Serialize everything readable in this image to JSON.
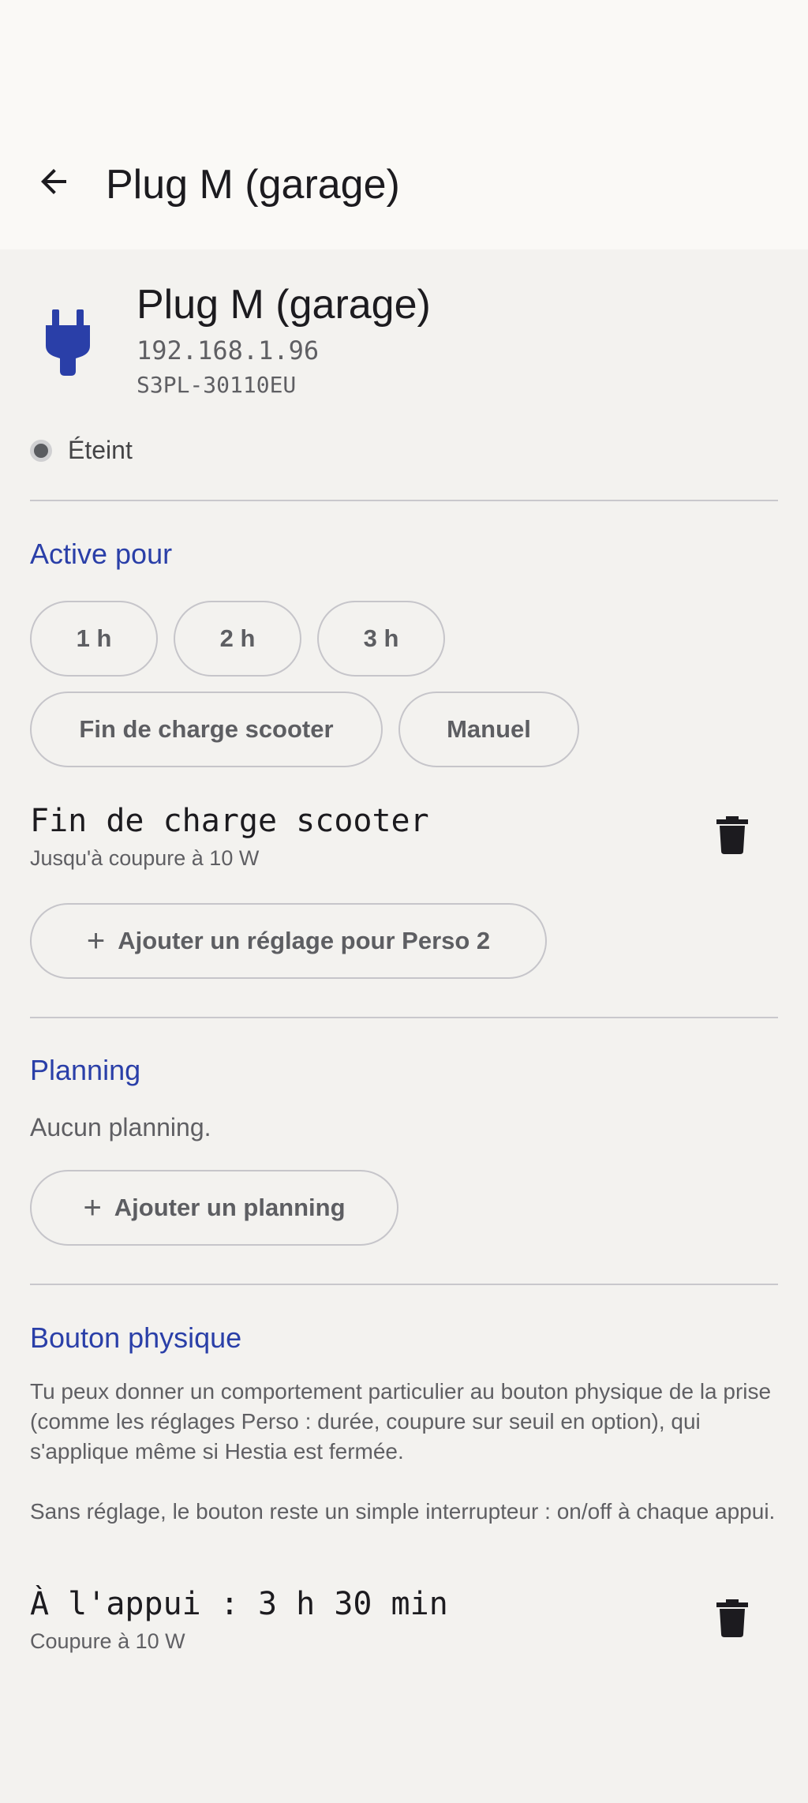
{
  "appbar": {
    "back_icon": "arrow-back-icon",
    "title": "Plug M (garage)"
  },
  "device": {
    "icon": "power-plug-icon",
    "accent_color": "#2a3fa8",
    "name": "Plug M (garage)",
    "ip": "192.168.1.96",
    "model": "S3PL-30110EU",
    "status": "Éteint"
  },
  "active": {
    "title": "Active pour",
    "chips": [
      "1 h",
      "2 h",
      "3 h",
      "Fin de charge scooter",
      "Manuel"
    ],
    "setting": {
      "title": "Fin de charge scooter",
      "subtitle": "Jusqu'à coupure à 10 W"
    },
    "add_label": "Ajouter un réglage pour Perso 2"
  },
  "planning": {
    "title": "Planning",
    "empty_text": "Aucun planning.",
    "add_label": "Ajouter un planning"
  },
  "physical_button": {
    "title": "Bouton physique",
    "paragraph1": "Tu peux donner un comportement particulier au bouton physique de la prise (comme les réglages Perso : durée, coupure sur seuil en option), qui s'applique même si Hestia est fermée.",
    "paragraph2": "Sans réglage, le bouton reste un simple interrupteur : on/off à chaque appui.",
    "setting": {
      "title": "À l'appui : 3 h 30 min",
      "subtitle": "Coupure à 10 W"
    }
  },
  "icons": {
    "add": "+",
    "delete": "trash-icon"
  }
}
